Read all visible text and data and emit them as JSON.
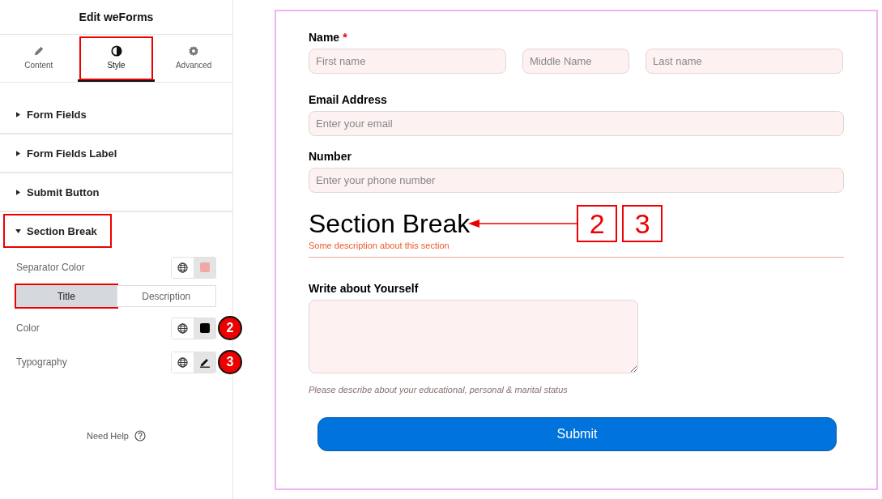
{
  "panel": {
    "title": "Edit weForms",
    "tabs": [
      {
        "label": "Content",
        "selected": false,
        "highlighted": false
      },
      {
        "label": "Style",
        "selected": true,
        "highlighted": true
      },
      {
        "label": "Advanced",
        "selected": false,
        "highlighted": false
      }
    ],
    "sections": [
      {
        "label": "Form Fields",
        "expanded": false,
        "highlighted": false
      },
      {
        "label": "Form Fields Label",
        "expanded": false,
        "highlighted": false
      },
      {
        "label": "Submit Button",
        "expanded": false,
        "highlighted": false
      },
      {
        "label": "Section Break",
        "expanded": true,
        "highlighted": true
      }
    ],
    "controls": [
      {
        "kind": "color",
        "label": "Separator Color",
        "color": "#f0a8a8"
      },
      {
        "kind": "toggle",
        "options": [
          {
            "label": "Title",
            "selected": true,
            "highlighted": true
          },
          {
            "label": "Description",
            "selected": false,
            "highlighted": false
          }
        ]
      },
      {
        "kind": "color",
        "label": "Color",
        "color": "#000000",
        "badge": "2"
      },
      {
        "kind": "edit",
        "label": "Typography",
        "badge": "3"
      }
    ],
    "help": "Need Help"
  },
  "form": {
    "name": {
      "label": "Name",
      "required_mark": "*",
      "placeholders": [
        "First name",
        "Middle Name",
        "Last name"
      ]
    },
    "fields": [
      {
        "label": "Email Address",
        "placeholder": "Enter your email"
      },
      {
        "label": "Number",
        "placeholder": "Enter your phone number"
      }
    ],
    "section_break": {
      "title": "Section Break",
      "description": "Some description about this section",
      "callouts": [
        "2",
        "3"
      ]
    },
    "textarea": {
      "label": "Write about Yourself",
      "help": "Please describe about your educational, personal & marital status"
    },
    "submit": "Submit"
  }
}
